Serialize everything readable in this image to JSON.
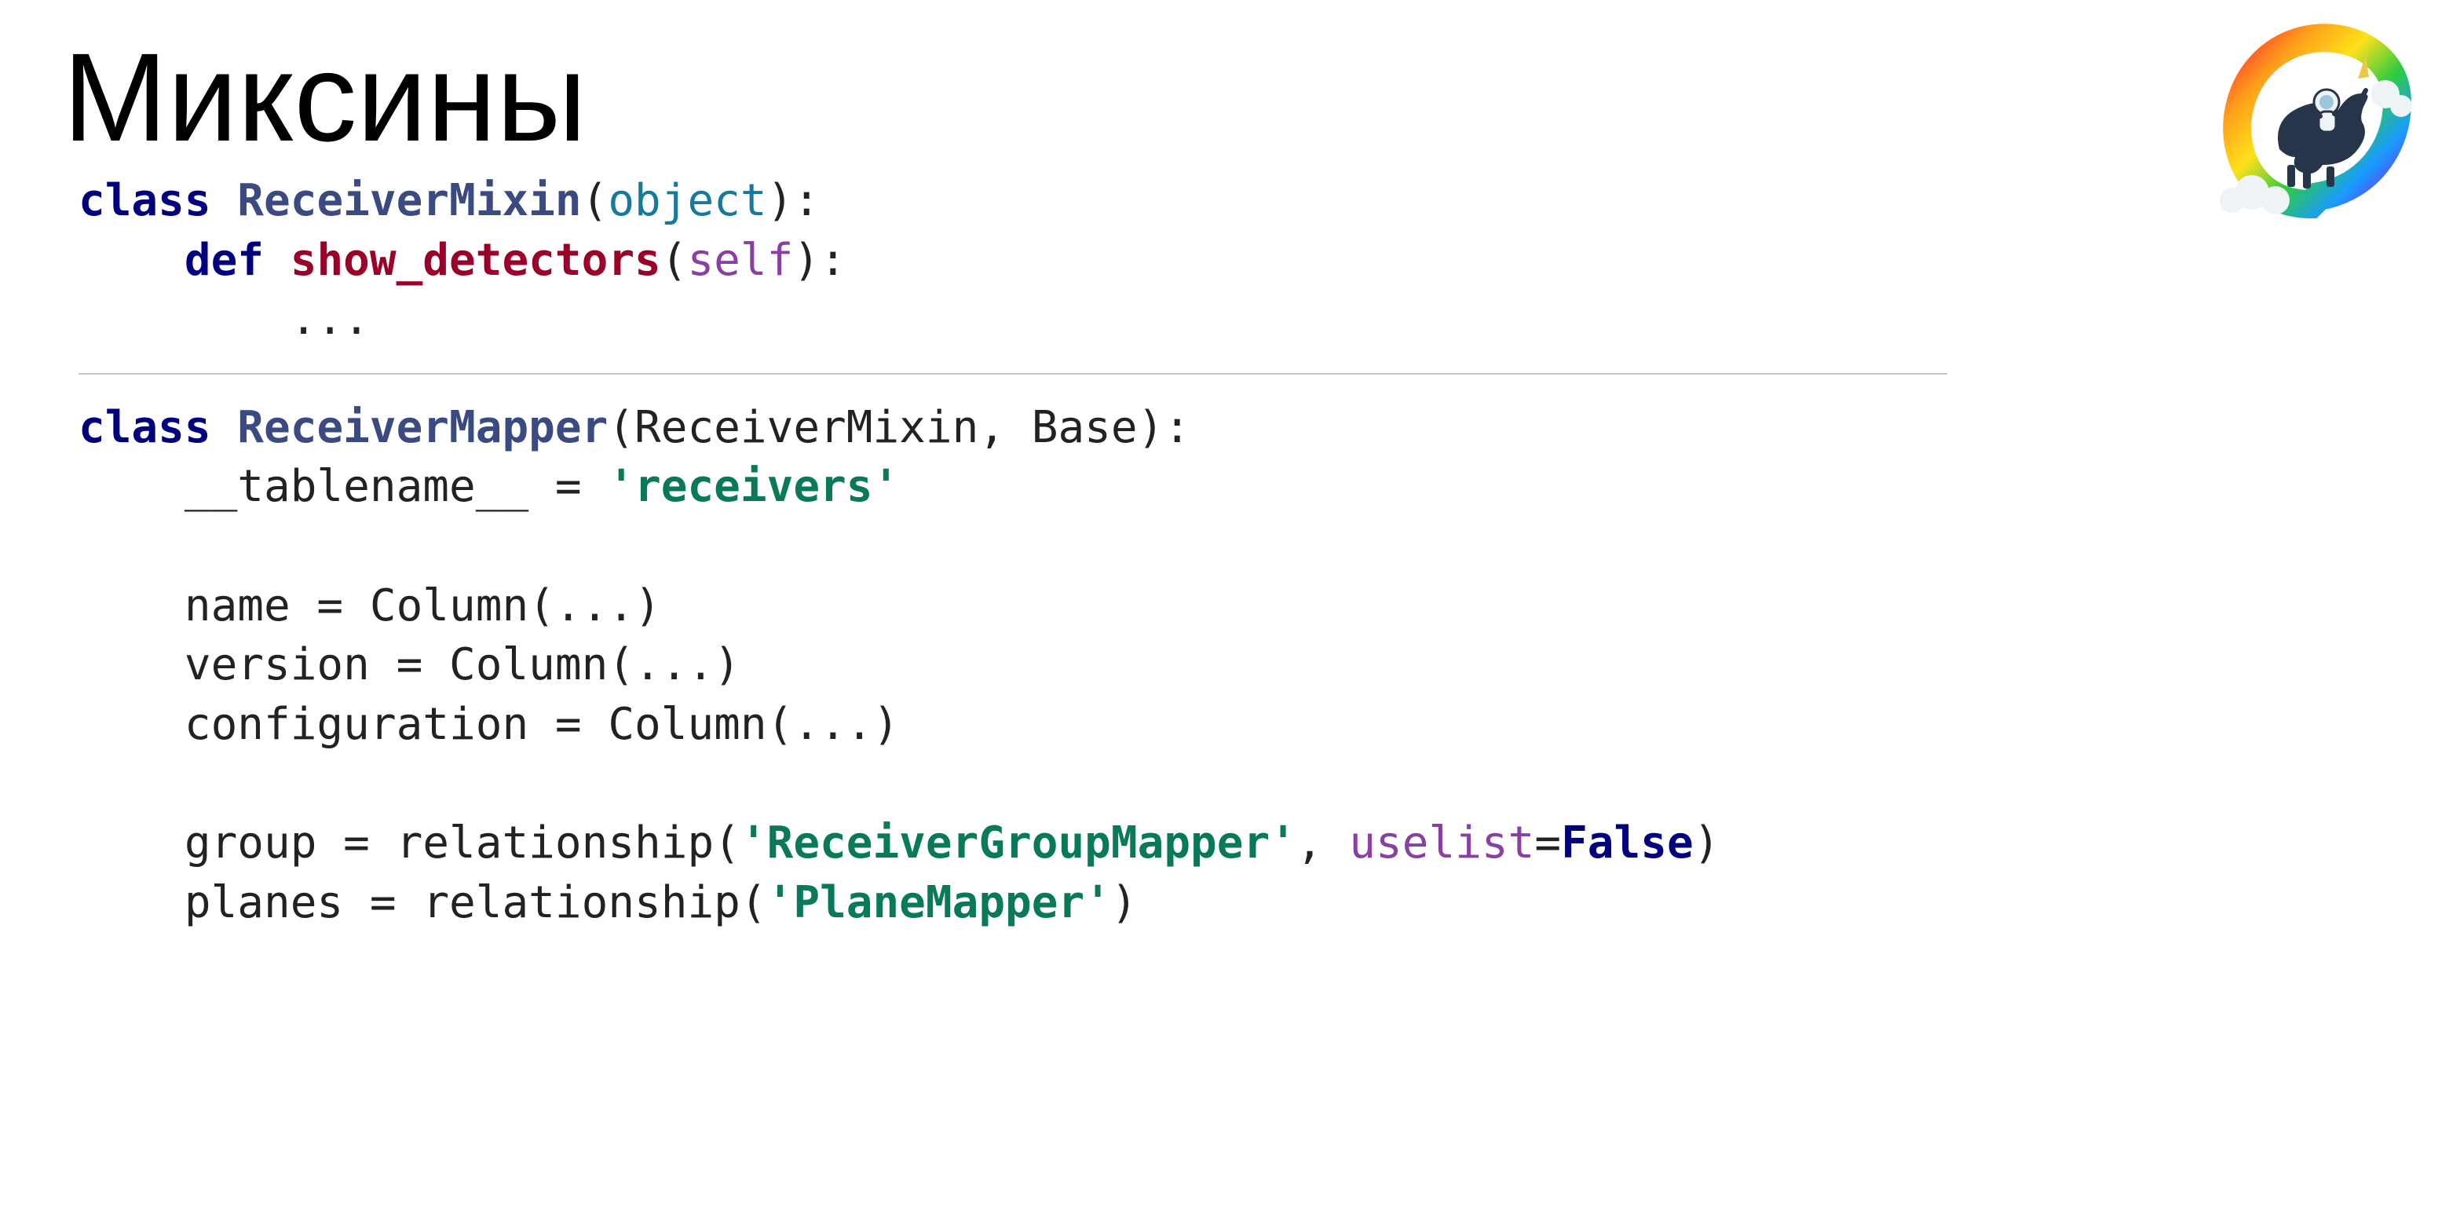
{
  "header": {
    "title": "Миксины"
  },
  "code": {
    "block1": {
      "l1": {
        "kw_class": "class",
        "cls": "ReceiverMixin",
        "paren_open": "(",
        "base": "object",
        "paren_close_colon": "):"
      },
      "l2": {
        "indent": "    ",
        "kw_def": "def",
        "fn": "show_detectors",
        "paren_open": "(",
        "self": "self",
        "paren_close_colon": "):"
      },
      "l3": {
        "indent": "        ",
        "ellipsis": "..."
      }
    },
    "block2": {
      "l1": {
        "kw_class": "class",
        "cls": "ReceiverMapper",
        "paren_open": "(",
        "bases": "ReceiverMixin, Base",
        "paren_close_colon": "):"
      },
      "l2": {
        "indent": "    ",
        "attr": "__tablename__",
        "eq": " = ",
        "str": "'receivers'"
      },
      "l3": {
        "blank": ""
      },
      "l4": {
        "indent": "    ",
        "attr": "name",
        "eq": " = ",
        "call": "Column(...)"
      },
      "l5": {
        "indent": "    ",
        "attr": "version",
        "eq": " = ",
        "call": "Column(...)"
      },
      "l6": {
        "indent": "    ",
        "attr": "configuration",
        "eq": " = ",
        "call": "Column(...)"
      },
      "l7": {
        "blank": ""
      },
      "l8": {
        "indent": "    ",
        "attr": "group",
        "eq": " = ",
        "fn": "relationship(",
        "str": "'ReceiverGroupMapper'",
        "comma": ", ",
        "kwarg": "uselist",
        "eq2": "=",
        "val": "False",
        "close": ")"
      },
      "l9": {
        "indent": "    ",
        "attr": "planes",
        "eq": " = ",
        "fn": "relationship(",
        "str": "'PlaneMapper'",
        "close": ")"
      }
    }
  }
}
